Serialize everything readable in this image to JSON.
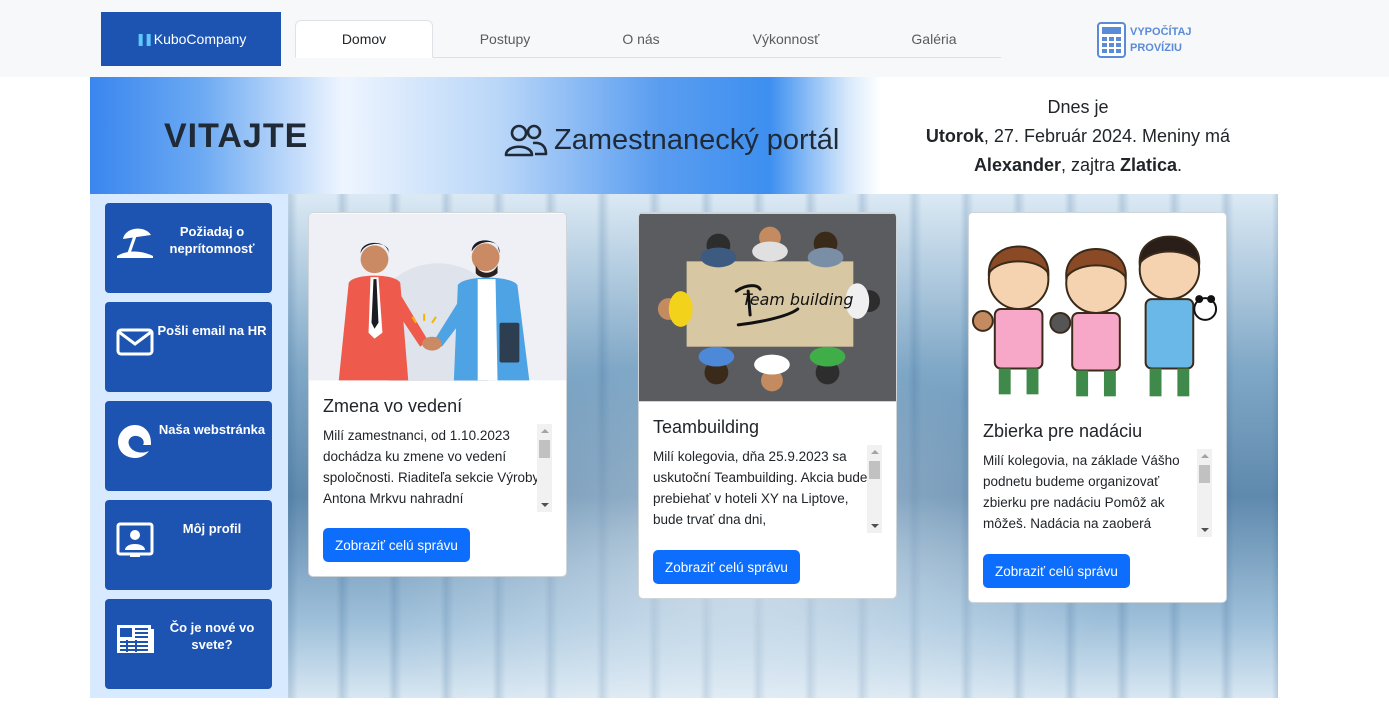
{
  "nav": {
    "logo_mark": "❚❚",
    "logo_text": "KuboCompany",
    "tabs": [
      {
        "label": "Domov",
        "active": true
      },
      {
        "label": "Postupy",
        "active": false
      },
      {
        "label": "O nás",
        "active": false
      },
      {
        "label": "Výkonnosť",
        "active": false
      },
      {
        "label": "Galéria",
        "active": false
      }
    ],
    "calc_line1": "VYPOČÍTAJ",
    "calc_line2": "PROVÍZIU",
    "calc_icon": "calculator-icon"
  },
  "hero": {
    "welcome": "VITAJTE",
    "portal_icon": "users-icon",
    "portal_title": "Zamestnanecký portál",
    "today_label": "Dnes je",
    "day": "Utorok",
    "date_rest": ", 27. Február 2024. Meniny má",
    "name_today": "Alexander",
    "tomorrow_label": ", zajtra ",
    "name_tomorrow": "Zlatica",
    "end_dot": "."
  },
  "sidebar": {
    "items": [
      {
        "label": "Požiadaj o neprítomnosť",
        "icon": "beach-umbrella-icon"
      },
      {
        "label": "Pošli email na HR",
        "icon": "envelope-icon"
      },
      {
        "label": "Naša webstránka",
        "icon": "edge-browser-icon"
      },
      {
        "label": "Môj profil",
        "icon": "profile-icon"
      },
      {
        "label": "Čo je nové vo svete?",
        "icon": "newspaper-icon"
      }
    ]
  },
  "cards": [
    {
      "title": "Zmena vo vedení",
      "text": "Milí zamestnanci, od 1.10.2023 dochádza ku zmene vo vedení spoločnosti. Riaditeľa sekcie Výroby Antona Mrkvu nahradní",
      "button": "Zobraziť celú správu",
      "image": "handshake-illustration"
    },
    {
      "title": "Teambuilding",
      "text": "Milí kolegovia, dňa 25.9.2023 sa uskutoční Teambuilding. Akcia bude prebiehať v hoteli XY na Liptove, bude trvať dna dni,",
      "button": "Zobraziť celú správu",
      "image": "teambuilding-photo",
      "image_text": "Team building"
    },
    {
      "title": "Zbierka pre nadáciu",
      "text": "Milí kolegovia, na základe Vášho podnetu budeme organizovať zbierku pre nadáciu Pomôž ak môžeš. Nadácia na zaoberá",
      "button": "Zobraziť celú správu",
      "image": "children-puppets-illustration"
    }
  ],
  "colors": {
    "brand": "#1d54b1",
    "primary_button": "#0d6efd",
    "sidebar_bg": "#d8eaff",
    "calc_accent": "#5b8ad6"
  }
}
